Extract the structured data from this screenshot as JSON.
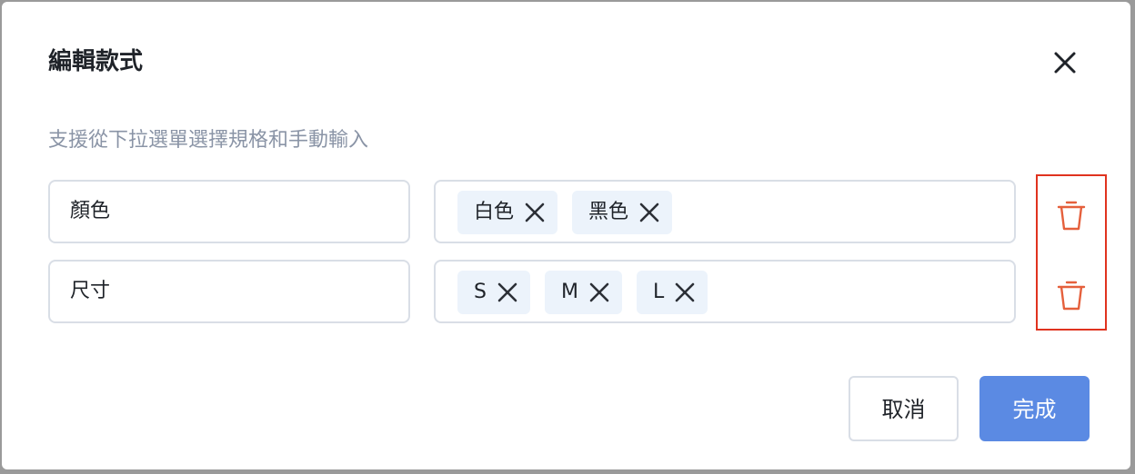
{
  "dialog": {
    "title": "編輯款式",
    "subtitle": "支援從下拉選單選擇規格和手動輸入",
    "close_icon": "close-icon"
  },
  "specs": [
    {
      "name": "顏色",
      "values": [
        "白色",
        "黑色"
      ]
    },
    {
      "name": "尺寸",
      "values": [
        "S",
        "M",
        "L"
      ]
    }
  ],
  "footer": {
    "cancel_label": "取消",
    "done_label": "完成"
  },
  "colors": {
    "primary": "#5b8ae3",
    "danger_icon": "#e5603c",
    "highlight_border": "#e0331f",
    "tag_bg": "#ecf3fb"
  }
}
